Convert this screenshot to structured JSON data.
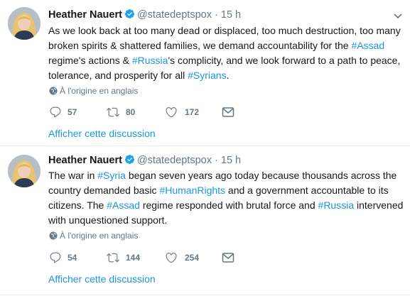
{
  "tweets": [
    {
      "author_name": "Heather Nauert",
      "handle": "@statedeptspox",
      "separator": "·",
      "time": "15 h",
      "lines": [
        [
          {
            "t": "As we look back at too many dead or displaced, too much destruction, too many",
            "h": false
          }
        ],
        [
          {
            "t": "broken spirits & shattered families, we demand accountability for the ",
            "h": false
          },
          {
            "t": "#Assad",
            "h": true
          }
        ],
        [
          {
            "t": "regime's actions & ",
            "h": false
          },
          {
            "t": "#Russia",
            "h": true
          },
          {
            "t": "'s complicity, and we look forward to a path to peace,",
            "h": false
          }
        ],
        [
          {
            "t": "tolerance, and prosperity for all ",
            "h": false
          },
          {
            "t": "#Syrians",
            "h": true
          },
          {
            "t": ".",
            "h": false
          }
        ]
      ],
      "translate_label": "À l'origine en anglais",
      "replies": "57",
      "retweets": "80",
      "likes": "172",
      "thread_link": "Afficher cette discussion"
    },
    {
      "author_name": "Heather Nauert",
      "handle": "@statedeptspox",
      "separator": "·",
      "time": "15 h",
      "lines": [
        [
          {
            "t": "The war in ",
            "h": false
          },
          {
            "t": "#Syria",
            "h": true
          },
          {
            "t": " began seven years ago today because thousands across the",
            "h": false
          }
        ],
        [
          {
            "t": "country demanded basic ",
            "h": false
          },
          {
            "t": "#HumanRights",
            "h": true
          },
          {
            "t": " and a government accountable to its",
            "h": false
          }
        ],
        [
          {
            "t": "citizens. The ",
            "h": false
          },
          {
            "t": "#Assad",
            "h": true
          },
          {
            "t": " regime responded with brutal force and ",
            "h": false
          },
          {
            "t": "#Russia",
            "h": true
          },
          {
            "t": " intervened",
            "h": false
          }
        ],
        [
          {
            "t": "with unquestioned support.",
            "h": false
          }
        ]
      ],
      "translate_label": "À l'origine en anglais",
      "replies": "54",
      "retweets": "144",
      "likes": "254",
      "thread_link": "Afficher cette discussion"
    }
  ],
  "icons": {
    "verified": "verified-badge-icon",
    "caret": "chevron-down-icon",
    "globe": "globe-icon",
    "reply": "reply-icon",
    "retweet": "retweet-icon",
    "like": "heart-icon",
    "message": "envelope-icon"
  },
  "colors": {
    "link": "#1b95e0",
    "muted": "#657786",
    "text": "#14171a",
    "divider": "#e6ecf0"
  }
}
